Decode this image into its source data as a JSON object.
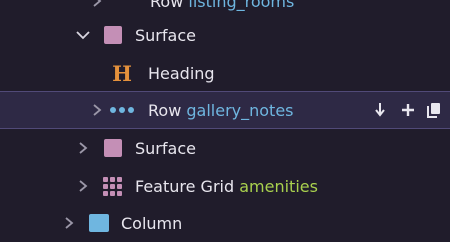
{
  "tree": {
    "rows": [
      {
        "label": "Row",
        "sub": "listing_rooms"
      },
      {
        "label": "Surface"
      },
      {
        "label": "Heading"
      },
      {
        "label": "Row",
        "sub": "gallery_notes"
      },
      {
        "label": "Surface"
      },
      {
        "label": "Feature Grid",
        "sub": "amenities"
      },
      {
        "label": "Column"
      }
    ]
  },
  "colors": {
    "background": "#201c2b",
    "selected_row": "#2e2945",
    "surface_icon": "#c48fb6",
    "heading_icon": "#e5913c",
    "row_icon": "#6fb6e0",
    "sub_label_blue": "#6fb6e0",
    "sub_label_green": "#a9d14e"
  },
  "icons": {
    "expand": "chevron-right-icon",
    "collapse": "chevron-down-icon",
    "surface": "square-icon",
    "heading": "h-letter-icon",
    "row": "three-dots-icon",
    "feature_grid": "grid-icon",
    "actions": [
      "arrow-down-icon",
      "plus-icon",
      "copy-icon"
    ]
  }
}
